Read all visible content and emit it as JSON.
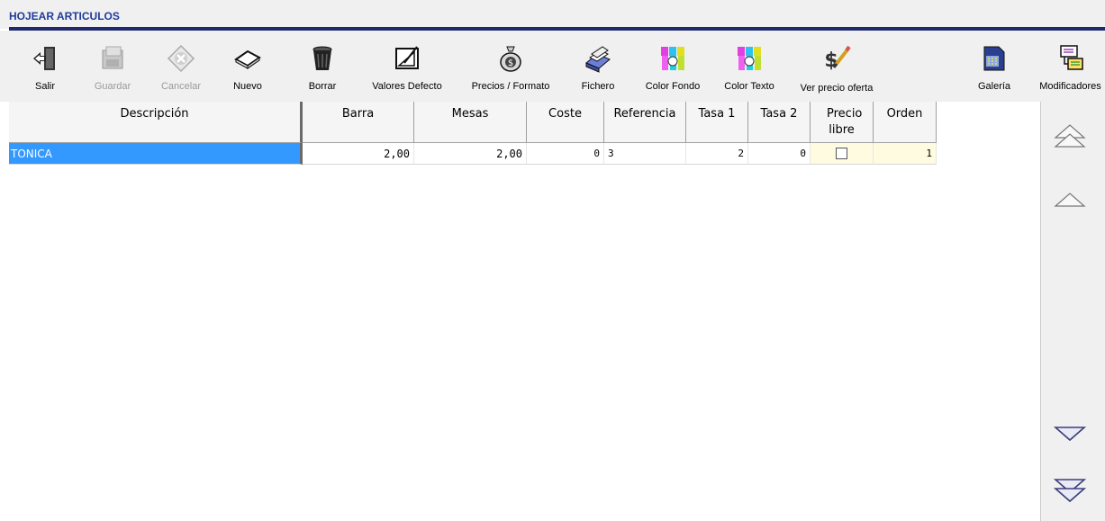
{
  "window": {
    "title": "HOJEAR ARTICULOS"
  },
  "toolbar": {
    "buttons": [
      {
        "label": "Salir",
        "icon": "exit-door-icon",
        "enabled": true
      },
      {
        "label": "Guardar",
        "icon": "save-icon",
        "enabled": false
      },
      {
        "label": "Cancelar",
        "icon": "cancel-icon",
        "enabled": false
      },
      {
        "label": "Nuevo",
        "icon": "new-icon",
        "enabled": true
      },
      {
        "label": "Borrar",
        "icon": "trash-icon",
        "enabled": true
      },
      {
        "label": "Valores Defecto",
        "icon": "default-values-icon",
        "enabled": true
      },
      {
        "label": "Precios / Formato",
        "icon": "money-bag-icon",
        "enabled": true
      },
      {
        "label": "Fichero",
        "icon": "card-file-icon",
        "enabled": true
      },
      {
        "label": "Color Fondo",
        "icon": "paint-bottles-icon",
        "enabled": true
      },
      {
        "label": "Color Texto",
        "icon": "paint-bottles-icon",
        "enabled": true
      },
      {
        "label": "Ver precio oferta",
        "icon": "price-tag-icon",
        "enabled": true
      },
      {
        "label": "Galería",
        "icon": "gallery-icon",
        "enabled": true
      },
      {
        "label": "Modificadores",
        "icon": "modifiers-icon",
        "enabled": true
      }
    ]
  },
  "grid": {
    "columns": [
      {
        "label": "Descripción"
      },
      {
        "label": "Barra"
      },
      {
        "label": "Mesas"
      },
      {
        "label": "Coste"
      },
      {
        "label": "Referencia"
      },
      {
        "label": "Tasa 1"
      },
      {
        "label": "Tasa 2"
      },
      {
        "label": "Precio libre"
      },
      {
        "label": "Orden"
      }
    ],
    "rows": [
      {
        "descripcion": "TONICA",
        "barra": "2,00",
        "mesas": "2,00",
        "coste": "0",
        "referencia": "3",
        "tasa1": "2",
        "tasa2": "0",
        "precio_libre": false,
        "orden": "1"
      }
    ]
  },
  "scroll": {
    "buttons": [
      "double-up-arrow-icon",
      "up-arrow-icon",
      "down-arrow-icon",
      "double-down-arrow-icon"
    ]
  },
  "colors": {
    "title": "#1f3b9c",
    "title_line": "#1f2a6e",
    "selection": "#3399ff",
    "toolbar_bg": "#f0f0f0"
  }
}
